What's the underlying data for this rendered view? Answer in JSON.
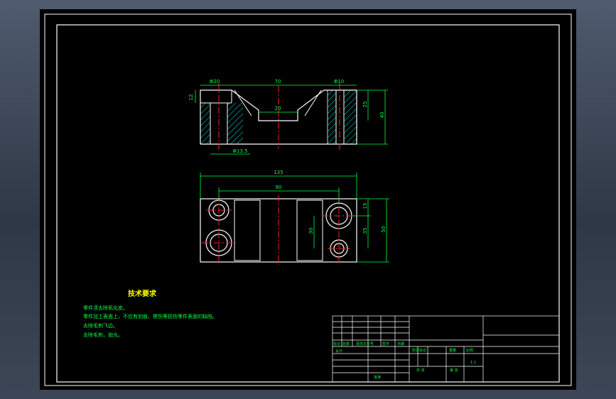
{
  "dimensions": {
    "top_view": {
      "left_hole_dia": "Φ20",
      "top_width": "70",
      "right_hole_dia": "Φ10",
      "counterbore_depth": "12",
      "slot_bottom_width": "20",
      "depth_25": "25",
      "height_40": "40",
      "bottom_hole_dia": "Φ13.5"
    },
    "plan_view": {
      "overall_length": "135",
      "hole_spacing": "90",
      "dim_15": "15",
      "dim_35": "35",
      "dim_30": "30",
      "overall_width": "50"
    }
  },
  "notes": {
    "title": "技术要求",
    "lines": [
      "零件须去除氧化皮。",
      "零件加工表面上，不应有划痕、擦伤等损伤零件表面的缺陷。",
      "去除毛刺飞边。",
      "去除毛刺，抛光。"
    ]
  },
  "title_block": {
    "row_labels": [
      "标记",
      "处数",
      "更改文件号",
      "签字",
      "日期"
    ],
    "design_label": "设计",
    "stage_label": "阶段标记",
    "weight_label": "重量",
    "scale_label": "比例",
    "scale_value": "1:1",
    "approve_label": "批准",
    "sheets_total_label": "共 张",
    "sheet_label": "第 张"
  },
  "colors": {
    "outline": "#ffffff",
    "centerline": "#ff2020",
    "dimension": "#00ff40",
    "hatch": "#00ffff",
    "notes": "#ffff00",
    "text_green": "#00ff40"
  }
}
